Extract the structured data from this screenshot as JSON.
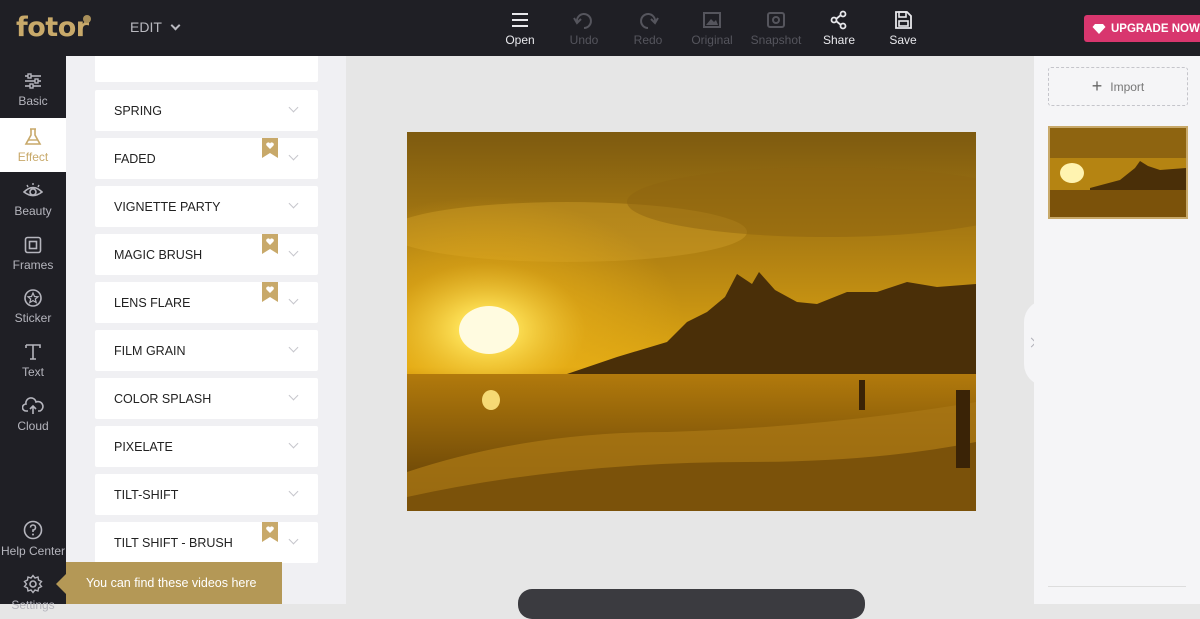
{
  "app": {
    "logo": "fotor",
    "edit_label": "EDIT"
  },
  "toolbar": [
    {
      "label": "Open",
      "icon": "hamburger-icon",
      "enabled": true
    },
    {
      "label": "Undo",
      "icon": "undo-icon",
      "enabled": false
    },
    {
      "label": "Redo",
      "icon": "redo-icon",
      "enabled": false
    },
    {
      "label": "Original",
      "icon": "image-icon",
      "enabled": false
    },
    {
      "label": "Snapshot",
      "icon": "camera-icon",
      "enabled": false
    },
    {
      "label": "Share",
      "icon": "share-icon",
      "enabled": true
    },
    {
      "label": "Save",
      "icon": "save-icon",
      "enabled": true
    }
  ],
  "upgrade": {
    "label": "UPGRADE NOW",
    "icon": "diamond-icon",
    "color": "#d8366e"
  },
  "nav": [
    {
      "label": "Basic",
      "icon": "sliders-icon",
      "active": false
    },
    {
      "label": "Effect",
      "icon": "flask-icon",
      "active": true
    },
    {
      "label": "Beauty",
      "icon": "eye-icon",
      "active": false
    },
    {
      "label": "Frames",
      "icon": "frame-icon",
      "active": false
    },
    {
      "label": "Sticker",
      "icon": "star-icon",
      "active": false
    },
    {
      "label": "Text",
      "icon": "text-icon",
      "active": false
    },
    {
      "label": "Cloud",
      "icon": "cloud-icon",
      "active": false
    },
    {
      "label": "Help Center",
      "icon": "question-icon",
      "active": false
    },
    {
      "label": "Settings",
      "icon": "gear-icon",
      "active": false
    }
  ],
  "effects": [
    {
      "label": "SPRING",
      "premium": false
    },
    {
      "label": "FADED",
      "premium": true
    },
    {
      "label": "VIGNETTE PARTY",
      "premium": false
    },
    {
      "label": "MAGIC BRUSH",
      "premium": true
    },
    {
      "label": "LENS FLARE",
      "premium": true
    },
    {
      "label": "FILM GRAIN",
      "premium": false
    },
    {
      "label": "COLOR SPLASH",
      "premium": false
    },
    {
      "label": "PIXELATE",
      "premium": false
    },
    {
      "label": "TILT-SHIFT",
      "premium": false
    },
    {
      "label": "TILT SHIFT - BRUSH",
      "premium": true
    }
  ],
  "tooltip": "You can find these videos here",
  "right_panel": {
    "import_label": "Import"
  },
  "colors": {
    "accent": "#c8a96a",
    "dark": "#1f1f25",
    "premium_badge": "#c8a96a"
  }
}
